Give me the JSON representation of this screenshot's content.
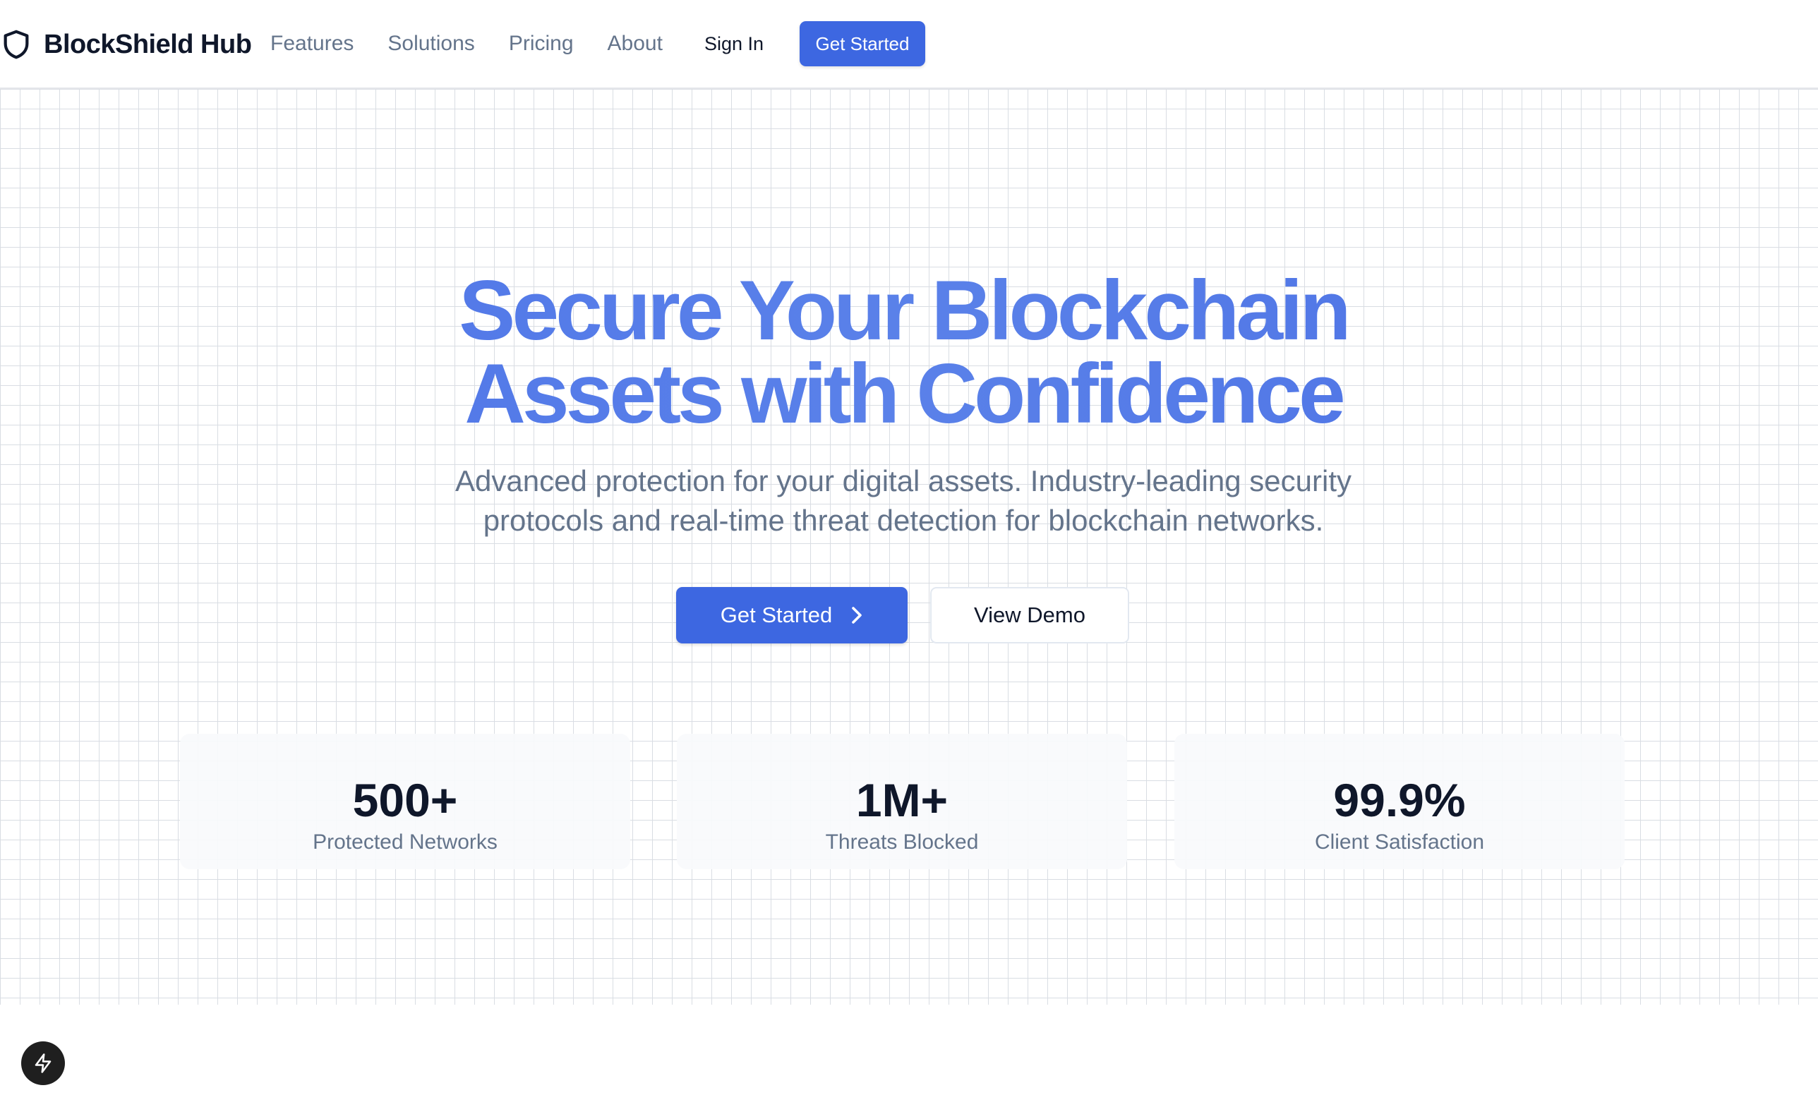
{
  "nav": {
    "brand": "BlockShield Hub",
    "links": [
      "Features",
      "Solutions",
      "Pricing",
      "About"
    ],
    "signin": "Sign In",
    "cta": "Get Started"
  },
  "hero": {
    "headline_line1": "Secure Your Blockchain",
    "headline_line2": "Assets with Confidence",
    "subtext": "Advanced protection for your digital assets. Industry-leading security protocols and real-time threat detection for blockchain networks.",
    "primary_button": "Get Started",
    "secondary_button": "View Demo"
  },
  "stats": [
    {
      "value": "500+",
      "label": "Protected Networks"
    },
    {
      "value": "1M+",
      "label": "Threats Blocked"
    },
    {
      "value": "99.9%",
      "label": "Client Satisfaction"
    }
  ],
  "colors": {
    "accent": "#3d67e1",
    "headline": "#4a74e6",
    "muted_text": "#64748b",
    "dark_text": "#0f172a"
  },
  "icons": {
    "brand": "shield-icon",
    "primary_button": "chevron-right-icon",
    "badge": "lightning-bolt-icon"
  }
}
